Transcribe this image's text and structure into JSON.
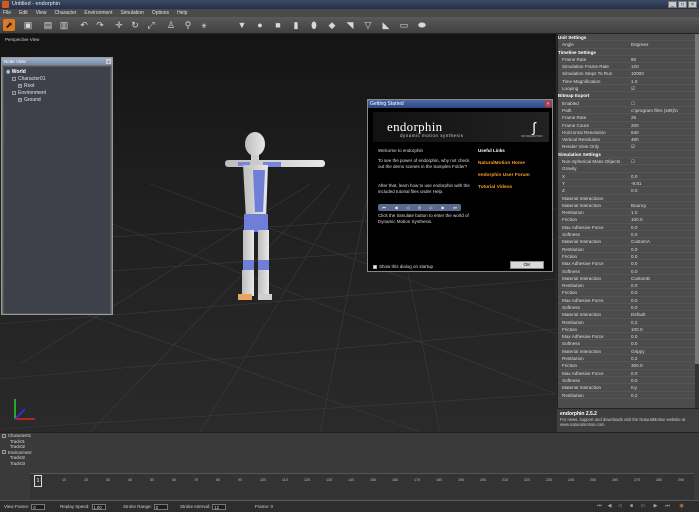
{
  "window": {
    "title": "Untitled - endorphin",
    "buttons": [
      "_",
      "□",
      "×"
    ]
  },
  "menu": [
    "File",
    "Edit",
    "View",
    "Character",
    "Environment",
    "Simulation",
    "Options",
    "Help"
  ],
  "viewport": {
    "label": "Perspective View"
  },
  "node_view": {
    "title": "Node View",
    "items": [
      {
        "label": "World",
        "level": 0,
        "toggle": ""
      },
      {
        "label": "Character01",
        "level": 1,
        "toggle": "-"
      },
      {
        "label": "Root",
        "level": 2,
        "toggle": "+"
      },
      {
        "label": "Environment",
        "level": 1,
        "toggle": "-"
      },
      {
        "label": "Ground",
        "level": 2,
        "toggle": "+"
      }
    ]
  },
  "dialog": {
    "title": "Getting Started",
    "logo_text": "endorphin",
    "logo_sub": "dynamic motion synthesis",
    "brand_sub": "NATURALMOTION",
    "welcome": "Welcome to endorphin",
    "para1": "To see the power of endorphin, why not check out the demo scenes in the Samples Folder?",
    "para2": "After that, learn how to use endorphin with the included tutorial files under Help.",
    "para3": "Click the Simulate button to enter the world of Dynamic Motion Synthesis.",
    "useful_links_title": "Useful Links",
    "links": [
      "NaturalMotion Home",
      "endorphin User Forum",
      "Tutorial Videos"
    ],
    "checkbox_label": "Show this dialog on startup",
    "ok_label": "OK"
  },
  "properties": [
    {
      "k": "Unit Settings",
      "v": "",
      "type": "hdr"
    },
    {
      "k": "Angle",
      "v": "Degrees",
      "type": "sub"
    },
    {
      "k": "Timeline Settings",
      "v": "",
      "type": "hdr"
    },
    {
      "k": "Frame Rate",
      "v": "60",
      "type": "sub"
    },
    {
      "k": "Simulation Frame Rate",
      "v": "120",
      "type": "sub"
    },
    {
      "k": "Simulation Steps To Run",
      "v": "10000",
      "type": "sub"
    },
    {
      "k": "Time Magnification",
      "v": "1.0",
      "type": "sub"
    },
    {
      "k": "Looping",
      "v": "☑",
      "type": "sub"
    },
    {
      "k": "Bitmap Export",
      "v": "",
      "type": "hdr"
    },
    {
      "k": "Enabled",
      "v": "☐",
      "type": "sub"
    },
    {
      "k": "Path",
      "v": "c:\\program files (x86)\\n",
      "type": "sub"
    },
    {
      "k": "Frame Rate",
      "v": "25",
      "type": "sub"
    },
    {
      "k": "Frame Count",
      "v": "200",
      "type": "sub"
    },
    {
      "k": "Horizontal Resolution",
      "v": "640",
      "type": "sub"
    },
    {
      "k": "Vertical Resolution",
      "v": "480",
      "type": "sub"
    },
    {
      "k": "Render View Only",
      "v": "☑",
      "type": "sub"
    },
    {
      "k": "Simulation Settings",
      "v": "",
      "type": "hdr"
    },
    {
      "k": "Non-Spherical Mass Objects",
      "v": "☐",
      "type": "sub"
    },
    {
      "k": "Gravity",
      "v": "",
      "type": "sub"
    },
    {
      "k": "X",
      "v": "0.0",
      "type": "sub"
    },
    {
      "k": "Y",
      "v": "-9.81",
      "type": "sub"
    },
    {
      "k": "Z",
      "v": "0.0",
      "type": "sub"
    },
    {
      "k": "Material Interactions",
      "v": "",
      "type": "sub"
    },
    {
      "k": "Material Interaction",
      "v": "Bouncy",
      "type": "sub"
    },
    {
      "k": "Restitution",
      "v": "1.0",
      "type": "sub"
    },
    {
      "k": "Friction",
      "v": "100.0",
      "type": "sub"
    },
    {
      "k": "Max Adhesive Force",
      "v": "0.0",
      "type": "sub"
    },
    {
      "k": "Softness",
      "v": "0.0",
      "type": "sub"
    },
    {
      "k": "Material Interaction",
      "v": "CustomA",
      "type": "sub"
    },
    {
      "k": "Restitution",
      "v": "0.0",
      "type": "sub"
    },
    {
      "k": "Friction",
      "v": "0.0",
      "type": "sub"
    },
    {
      "k": "Max Adhesive Force",
      "v": "0.0",
      "type": "sub"
    },
    {
      "k": "Softness",
      "v": "0.0",
      "type": "sub"
    },
    {
      "k": "Material Interaction",
      "v": "CustomB",
      "type": "sub"
    },
    {
      "k": "Restitution",
      "v": "0.0",
      "type": "sub"
    },
    {
      "k": "Friction",
      "v": "0.0",
      "type": "sub"
    },
    {
      "k": "Max Adhesive Force",
      "v": "0.0",
      "type": "sub"
    },
    {
      "k": "Softness",
      "v": "0.0",
      "type": "sub"
    },
    {
      "k": "Material Interaction",
      "v": "Default",
      "type": "sub"
    },
    {
      "k": "Restitution",
      "v": "0.2",
      "type": "sub"
    },
    {
      "k": "Friction",
      "v": "100.0",
      "type": "sub"
    },
    {
      "k": "Max Adhesive Force",
      "v": "0.0",
      "type": "sub"
    },
    {
      "k": "Softness",
      "v": "0.0",
      "type": "sub"
    },
    {
      "k": "Material Interaction",
      "v": "Grippy",
      "type": "sub"
    },
    {
      "k": "Restitution",
      "v": "0.2",
      "type": "sub"
    },
    {
      "k": "Friction",
      "v": "300.0",
      "type": "sub"
    },
    {
      "k": "Max Adhesive Force",
      "v": "0.0",
      "type": "sub"
    },
    {
      "k": "Softness",
      "v": "0.0",
      "type": "sub"
    },
    {
      "k": "Material Interaction",
      "v": "Icy",
      "type": "sub"
    },
    {
      "k": "Restitution",
      "v": "0.2",
      "type": "sub"
    }
  ],
  "props_footer": {
    "title": "endorphin 2.5.2",
    "text": "For news, support and downloads visit the NaturalMotion website at www.naturalmotion.com"
  },
  "timeline": {
    "tracks": [
      {
        "label": "Character01",
        "toggle": "-"
      },
      {
        "label": "Track01",
        "toggle": ""
      },
      {
        "label": "Track02",
        "toggle": ""
      },
      {
        "label": "Environment",
        "toggle": "-"
      },
      {
        "label": "Track02",
        "toggle": ""
      },
      {
        "label": "Track03",
        "toggle": ""
      }
    ],
    "ticks": [
      "1",
      "10",
      "20",
      "30",
      "40",
      "50",
      "60",
      "70",
      "80",
      "90",
      "100",
      "110",
      "120",
      "130",
      "140",
      "150",
      "160",
      "170",
      "180",
      "190",
      "200",
      "210",
      "220",
      "230",
      "240",
      "250",
      "260",
      "270",
      "280",
      "290"
    ],
    "playhead": "1"
  },
  "status": {
    "view_frame_label": "View Frame:",
    "view_frame": "0",
    "replay_speed_label": "Replay Speed:",
    "replay_speed": "1.00",
    "stroke_range_label": "Stroke Range:",
    "stroke_range": "0",
    "stroke_interval_label": "Stroke Interval:",
    "stroke_interval": "12",
    "frame_label": "Frame: 0"
  },
  "colors": {
    "accent": "#e07a1e",
    "link": "#f59a2c",
    "suit": "#6f7fd8"
  }
}
